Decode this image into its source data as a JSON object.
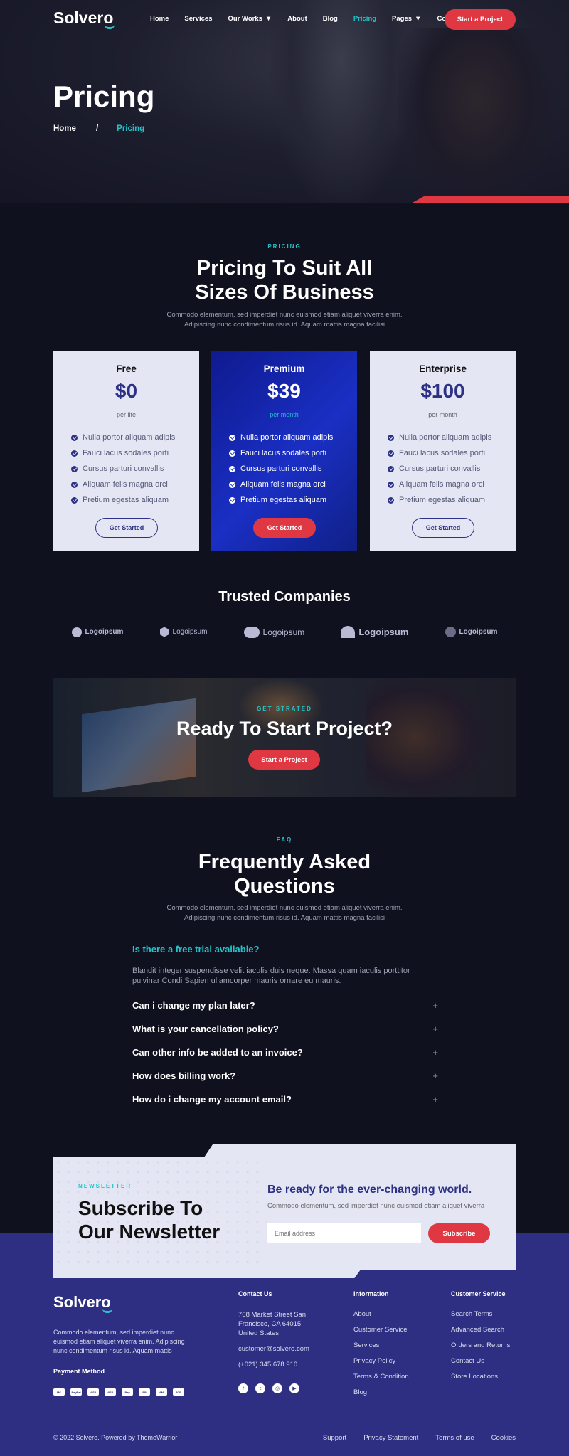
{
  "brand": {
    "name_prefix": "Solver",
    "name_suffix": "o"
  },
  "nav": {
    "items": [
      {
        "label": "Home"
      },
      {
        "label": "Services"
      },
      {
        "label": "Our Works"
      },
      {
        "label": "About"
      },
      {
        "label": "Blog"
      },
      {
        "label": "Pricing"
      },
      {
        "label": "Pages"
      },
      {
        "label": "Contact"
      }
    ],
    "cta": "Start a Project"
  },
  "hero": {
    "title": "Pricing",
    "breadcrumb": {
      "home": "Home",
      "sep": "/",
      "current": "Pricing"
    }
  },
  "pricing": {
    "eyebrow": "PRICING",
    "title_line1": "Pricing To Suit All",
    "title_line2": "Sizes Of Business",
    "sub_line1": "Commodo elementum, sed imperdiet nunc euismod etiam aliquet viverra enim.",
    "sub_line2": "Adipiscing nunc condimentum risus id. Aquam mattis magna facilisi",
    "plans": [
      {
        "name": "Free",
        "price": "$0",
        "period": "per life",
        "cta": "Get Started",
        "features": [
          "Nulla portor aliquam adipis",
          "Fauci lacus sodales porti",
          "Cursus parturi convallis",
          "Aliquam felis magna orci",
          "Pretium egestas aliquam"
        ]
      },
      {
        "name": "Premium",
        "price": "$39",
        "period": "per month",
        "cta": "Get Started",
        "features": [
          "Nulla portor aliquam adipis",
          "Fauci lacus sodales porti",
          "Cursus parturi convallis",
          "Aliquam felis magna orci",
          "Pretium egestas aliquam"
        ]
      },
      {
        "name": "Enterprise",
        "price": "$100",
        "period": "per month",
        "cta": "Get Started",
        "features": [
          "Nulla portor aliquam adipis",
          "Fauci lacus sodales porti",
          "Cursus parturi convallis",
          "Aliquam felis magna orci",
          "Pretium egestas aliquam"
        ]
      }
    ]
  },
  "trusted": {
    "title": "Trusted Companies",
    "logos": [
      "Logoipsum",
      "Logoipsum",
      "Logoipsum",
      "Logoipsum",
      "Logoipsum"
    ]
  },
  "cta_banner": {
    "eyebrow": "GET STRATED",
    "title": "Ready To Start Project?",
    "button": "Start a Project"
  },
  "faq": {
    "eyebrow": "FAQ",
    "title_line1": "Frequently Asked",
    "title_line2": "Questions",
    "sub_line1": "Commodo elementum, sed imperdiet nunc euismod etiam aliquet viverra enim.",
    "sub_line2": "Adipiscing nunc condimentum risus id. Aquam mattis magna facilisi",
    "items": [
      {
        "q": "Is there a free trial available?",
        "a": "Blandit integer suspendisse velit iaculis duis neque. Massa quam iaculis porttitor pulvinar Condi Sapien ullamcorper mauris ornare eu mauris.",
        "open": true
      },
      {
        "q": "Can i change my plan later?"
      },
      {
        "q": "What is your cancellation policy?"
      },
      {
        "q": "Can other info be added to an invoice?"
      },
      {
        "q": "How does billing work?"
      },
      {
        "q": "How do i change my account email?"
      }
    ]
  },
  "newsletter": {
    "eyebrow": "NEWSLETTER",
    "title_line1": "Subscribe To",
    "title_line2": "Our Newsletter",
    "heading": "Be ready for the ever-changing world.",
    "sub": "Commodo elementum, sed imperdiet nunc euismod etiam aliquet viverra",
    "placeholder": "Email address",
    "button": "Subscribe"
  },
  "footer": {
    "desc": "Commodo elementum, sed imperdiet nunc euismod etiam aliquet viverra enim. Adipiscing nunc condimentum risus id. Aquam mattis",
    "payment_title": "Payment Method",
    "payments": [
      "MC",
      "PayPal",
      "VISA",
      "VISA",
      "Pay",
      "PP",
      "AM",
      "JCB"
    ],
    "contact": {
      "title": "Contact Us",
      "address_line1": "768 Market Street San",
      "address_line2": "Francisco, CA 64015,",
      "address_line3": "United States",
      "email": "customer@solvero.com",
      "phone": "(+021) 345 678 910"
    },
    "info": {
      "title": "Information",
      "links": [
        "About",
        "Customer Service",
        "Services",
        "Privacy Policy",
        "Terms & Condition",
        "Blog"
      ]
    },
    "service": {
      "title": "Customer Service",
      "links": [
        "Search Terms",
        "Advanced Search",
        "Orders and Returns",
        "Contact Us",
        "Store Locations"
      ]
    },
    "copyright": "© 2022 Solvero. Powered by ThemeWarrior",
    "legal": [
      "Support",
      "Privacy Statement",
      "Terms of use",
      "Cookies"
    ]
  },
  "colors": {
    "accent_red": "#e03843",
    "accent_teal": "#22c3c9",
    "navy": "#2d3183",
    "footer_bg": "#2e2f83",
    "page_bg": "#10111f"
  }
}
